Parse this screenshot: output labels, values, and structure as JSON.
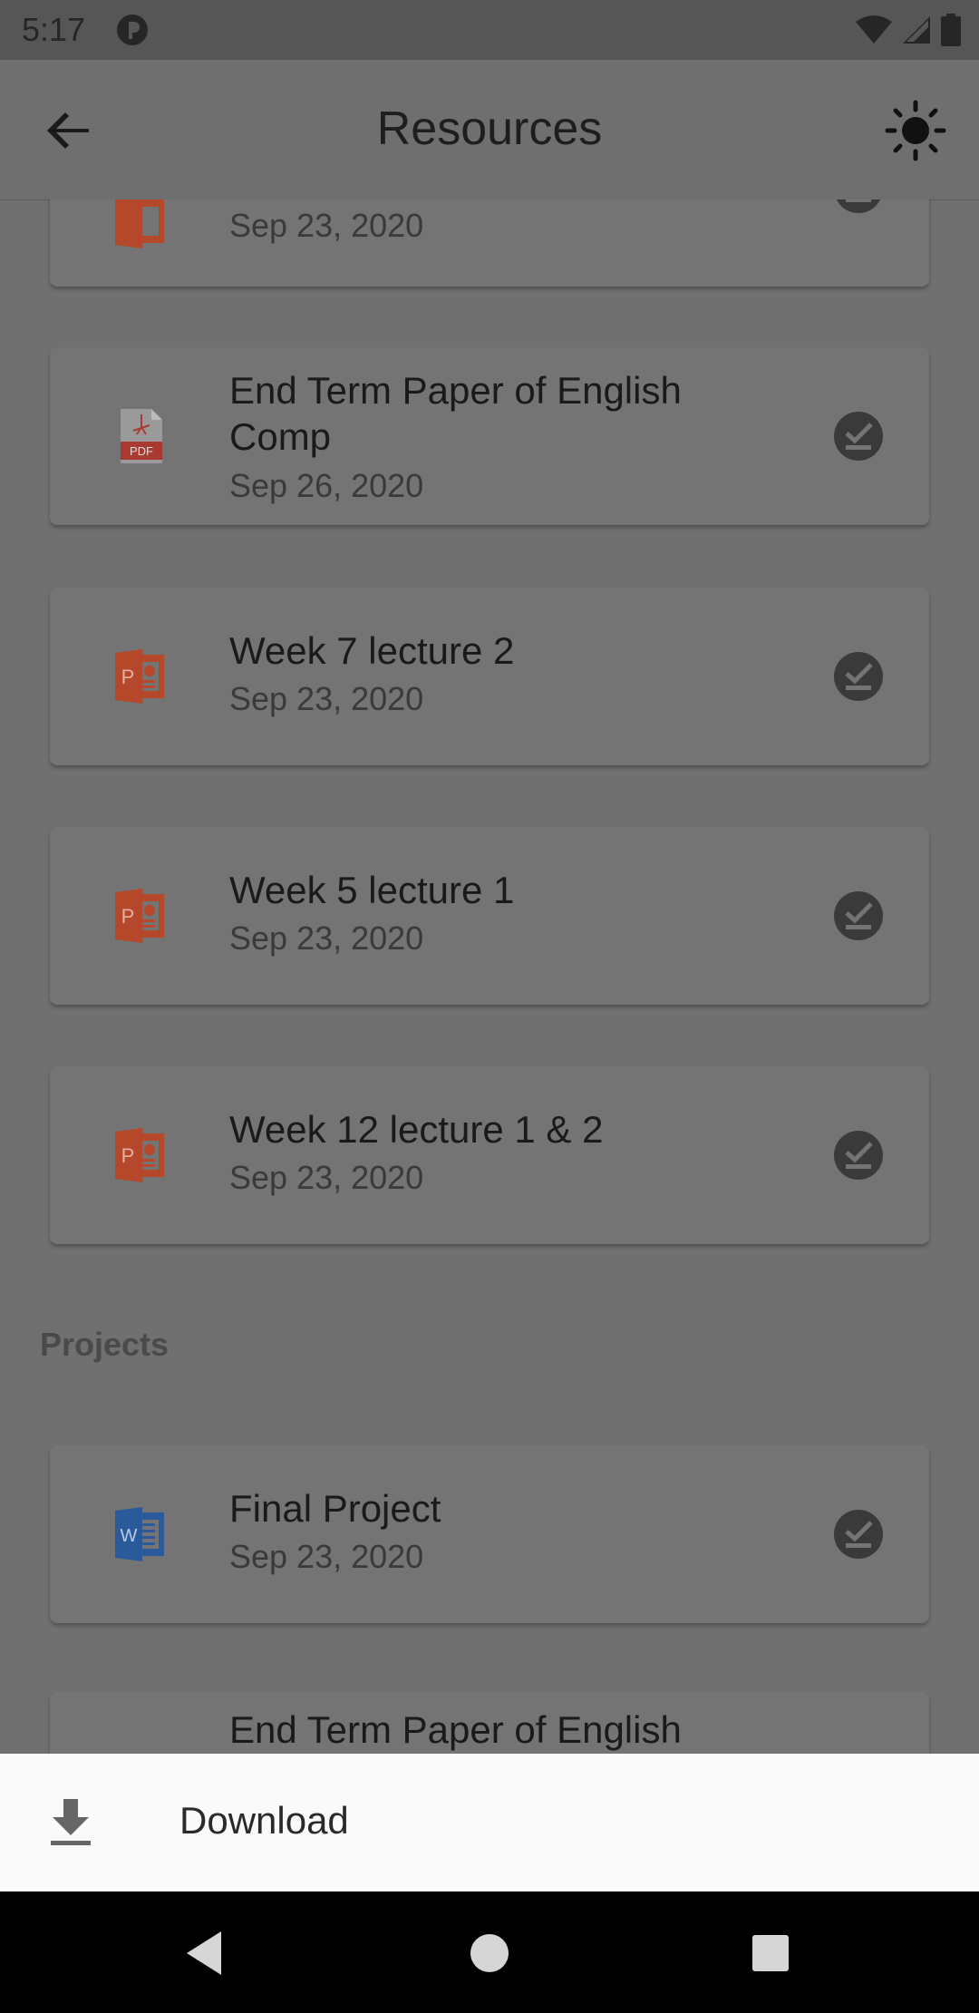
{
  "status_bar": {
    "time": "5:17",
    "icons": [
      "notification-app-icon",
      "wifi-icon",
      "cell-signal-icon",
      "battery-icon"
    ]
  },
  "app_bar": {
    "title": "Resources",
    "back_icon": "arrow-back-icon",
    "theme_icon": "brightness-icon"
  },
  "resources": [
    {
      "name": "",
      "date": "Sep 23, 2020",
      "type": "ppt",
      "partially_visible": true
    },
    {
      "name": "End Term Paper of English Comp",
      "date": "Sep 26, 2020",
      "type": "pdf"
    },
    {
      "name": "Week 7 lecture 2",
      "date": "Sep 23, 2020",
      "type": "ppt"
    },
    {
      "name": "Week 5 lecture 1",
      "date": "Sep 23, 2020",
      "type": "ppt"
    }
  ],
  "resources_extra": [
    {
      "name": "Week 12 lecture 1 & 2",
      "date": "Sep 23, 2020",
      "type": "ppt"
    }
  ],
  "projects_section": {
    "label": "Projects",
    "items": [
      {
        "name": "Final Project",
        "date": "Sep 23, 2020",
        "type": "doc"
      },
      {
        "name": "End Term Paper of English",
        "date": "",
        "type": "pdf",
        "partially_visible": true
      }
    ]
  },
  "bottom_sheet": {
    "download_label": "Download",
    "download_icon": "download-icon"
  },
  "nav_bar": {
    "buttons": [
      "back-triangle-icon",
      "home-circle-icon",
      "recents-square-icon"
    ]
  },
  "colors": {
    "ppt_icon": "#b5472a",
    "pdf_icon": "#a83a32",
    "doc_icon": "#2a5a9a",
    "check_bg": "#3a3a3a",
    "scrim": "#707070",
    "sheet_bg": "#fafafa"
  }
}
